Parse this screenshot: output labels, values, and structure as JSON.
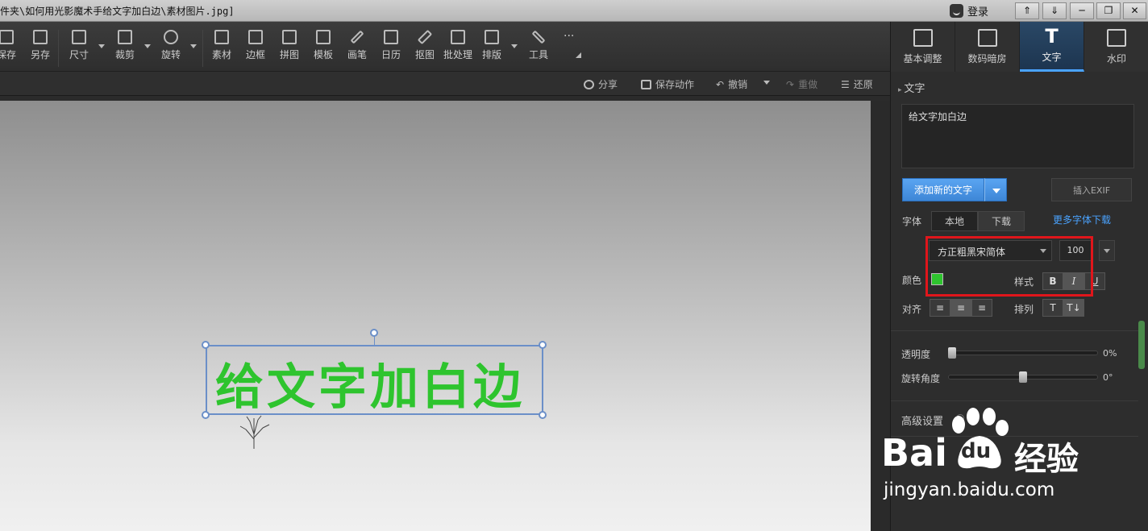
{
  "window": {
    "title": "件夹\\如何用光影魔术手给文字加白边\\素材图片.jpg]",
    "login_label": "登录",
    "controls": [
      "⇑",
      "⇓",
      "─",
      "❐",
      "✕"
    ]
  },
  "toolbar": {
    "items": [
      "保存",
      "另存",
      "尺寸",
      "裁剪",
      "旋转",
      "素材",
      "边框",
      "拼图",
      "模板",
      "画笔",
      "日历",
      "抠图",
      "批处理",
      "排版",
      "工具"
    ],
    "more": "···"
  },
  "right_tabs": {
    "items": [
      "基本调整",
      "数码暗房",
      "文字",
      "水印"
    ],
    "active": "文字",
    "active_icon": "T"
  },
  "action_bar": {
    "share": "分享",
    "save_action": "保存动作",
    "undo": "撤销",
    "redo": "重做",
    "restore": "还原"
  },
  "canvas": {
    "overlay_text": "给文字加白边",
    "text_color": "#2ec42e"
  },
  "panel": {
    "section_title": "文字",
    "text_value": "给文字加白边",
    "add_text_button": "添加新的文字",
    "insert_exif_button": "插入EXIF",
    "font_label": "字体",
    "font_tab_local": "本地",
    "font_tab_download": "下载",
    "more_fonts_link": "更多字体下载",
    "font_name": "方正粗黑宋简体",
    "font_size": "100",
    "color_label": "颜色",
    "color_value": "#2ec42e",
    "style_label": "样式",
    "style_buttons": [
      "B",
      "I",
      "U"
    ],
    "align_label": "对齐",
    "arrange_label": "排列",
    "opacity_label": "透明度",
    "opacity_value": "0%",
    "opacity_level": 0,
    "rotation_label": "旋转角度",
    "rotation_value": "0°",
    "rotation_level": 0.5,
    "advanced_label": "高级设置"
  },
  "watermark": {
    "brand_a": "Bai",
    "brand_b": "du",
    "brand_c": "经验",
    "url": "jingyan.baidu.com"
  }
}
